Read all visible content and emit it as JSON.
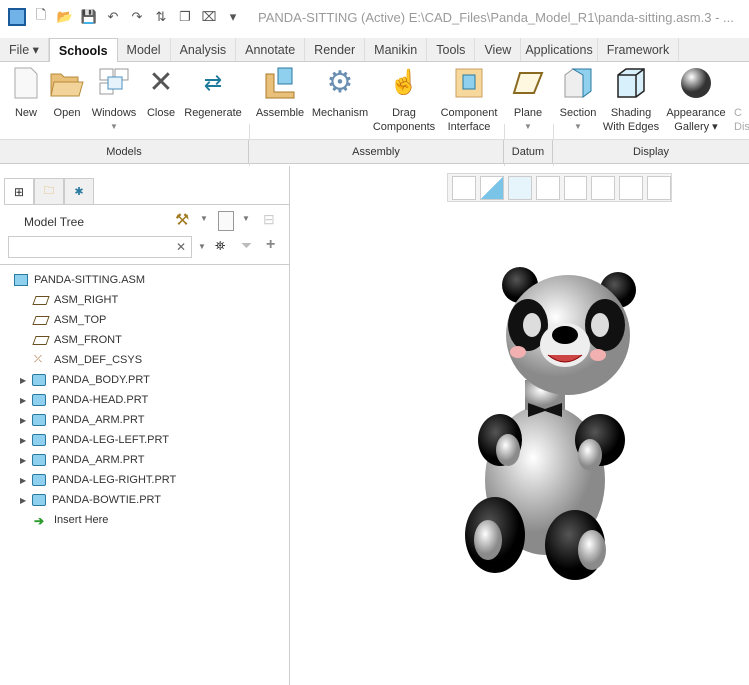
{
  "window": {
    "title": "PANDA-SITTING (Active) E:\\CAD_Files\\Panda_Model_R1\\panda-sitting.asm.3 - ..."
  },
  "tabs": [
    "File",
    "Schools",
    "Model",
    "Analysis",
    "Annotate",
    "Render",
    "Manikin",
    "Tools",
    "View",
    "Applications",
    "Framework"
  ],
  "ribbon": {
    "buttons": [
      {
        "label": "New"
      },
      {
        "label": "Open"
      },
      {
        "label": "Windows"
      },
      {
        "label": "Close"
      },
      {
        "label": "Regenerate"
      },
      {
        "label": "Assemble"
      },
      {
        "label": "Mechanism"
      },
      {
        "label": "Drag",
        "label2": "Components"
      },
      {
        "label": "Component",
        "label2": "Interface"
      },
      {
        "label": "Plane"
      },
      {
        "label": "Section"
      },
      {
        "label": "Shading",
        "label2": "With Edges"
      },
      {
        "label": "Appearance",
        "label2": "Gallery ▾"
      },
      {
        "label": "C",
        "label2": "Dis"
      }
    ],
    "groups": [
      "Models",
      "Assembly",
      "Datum",
      "Display"
    ]
  },
  "panel": {
    "title": "Model Tree",
    "search_value": "",
    "clear": "✕"
  },
  "tree": [
    {
      "label": "PANDA-SITTING.ASM",
      "type": "asm"
    },
    {
      "label": "ASM_RIGHT",
      "type": "plane"
    },
    {
      "label": "ASM_TOP",
      "type": "plane"
    },
    {
      "label": "ASM_FRONT",
      "type": "plane"
    },
    {
      "label": "ASM_DEF_CSYS",
      "type": "csys"
    },
    {
      "label": "PANDA_BODY.PRT",
      "type": "part"
    },
    {
      "label": "PANDA-HEAD.PRT",
      "type": "part"
    },
    {
      "label": "PANDA_ARM.PRT",
      "type": "part"
    },
    {
      "label": "PANDA-LEG-LEFT.PRT",
      "type": "part"
    },
    {
      "label": "PANDA_ARM.PRT",
      "type": "part"
    },
    {
      "label": "PANDA-LEG-RIGHT.PRT",
      "type": "part"
    },
    {
      "label": "PANDA-BOWTIE.PRT",
      "type": "part"
    },
    {
      "label": "Insert Here",
      "type": "insert"
    }
  ]
}
